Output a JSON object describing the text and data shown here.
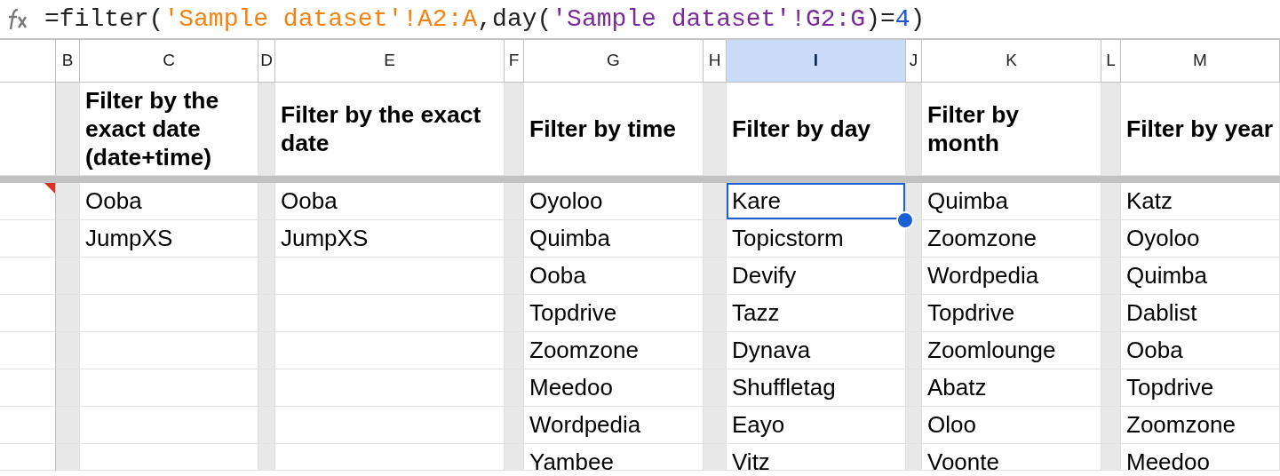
{
  "formula_bar": {
    "tokens": [
      {
        "text": "=filter(",
        "color": "#202124"
      },
      {
        "text": "'Sample dataset'!A2:A",
        "color": "#f4820f"
      },
      {
        "text": ",day(",
        "color": "#202124"
      },
      {
        "text": "'Sample dataset'!G2:G",
        "color": "#7b2a9c"
      },
      {
        "text": ")=",
        "color": "#202124"
      },
      {
        "text": "4",
        "color": "#1a56d6"
      },
      {
        "text": ")",
        "color": "#202124"
      }
    ]
  },
  "first_row_note": true,
  "columns": [
    {
      "letter": "B",
      "kind": "spacer",
      "selected": false
    },
    {
      "letter": "C",
      "kind": "data",
      "selected": false,
      "header": "Filter by the exact date (date+time)",
      "cells": [
        {
          "text": "Ooba",
          "selected": false
        },
        {
          "text": "JumpXS",
          "selected": false
        }
      ]
    },
    {
      "letter": "D",
      "kind": "spacer",
      "selected": false
    },
    {
      "letter": "E",
      "kind": "data",
      "selected": false,
      "header": "Filter by the exact date",
      "cells": [
        {
          "text": "Ooba",
          "selected": false
        },
        {
          "text": "JumpXS",
          "selected": false
        }
      ]
    },
    {
      "letter": "F",
      "kind": "spacer",
      "selected": false
    },
    {
      "letter": "G",
      "kind": "data",
      "selected": false,
      "header": "Filter by time",
      "cells": [
        {
          "text": "Oyoloo",
          "selected": false
        },
        {
          "text": "Quimba",
          "selected": false
        },
        {
          "text": "Ooba",
          "selected": false
        },
        {
          "text": "Topdrive",
          "selected": false
        },
        {
          "text": "Zoomzone",
          "selected": false
        },
        {
          "text": "Meedoo",
          "selected": false
        },
        {
          "text": "Wordpedia",
          "selected": false
        },
        {
          "text": "Yambee",
          "selected": false
        }
      ]
    },
    {
      "letter": "H",
      "kind": "spacer",
      "selected": false
    },
    {
      "letter": "I",
      "kind": "data",
      "selected": true,
      "header": "Filter by day",
      "cells": [
        {
          "text": "Kare",
          "selected": true
        },
        {
          "text": "Topicstorm",
          "selected": false
        },
        {
          "text": "Devify",
          "selected": false
        },
        {
          "text": "Tazz",
          "selected": false
        },
        {
          "text": "Dynava",
          "selected": false
        },
        {
          "text": "Shuffletag",
          "selected": false
        },
        {
          "text": "Eayo",
          "selected": false
        },
        {
          "text": "Vitz",
          "selected": false
        }
      ]
    },
    {
      "letter": "J",
      "kind": "spacer",
      "selected": false
    },
    {
      "letter": "K",
      "kind": "data",
      "selected": false,
      "header": "Filter by month",
      "cells": [
        {
          "text": "Quimba",
          "selected": false
        },
        {
          "text": "Zoomzone",
          "selected": false
        },
        {
          "text": "Wordpedia",
          "selected": false
        },
        {
          "text": "Topdrive",
          "selected": false
        },
        {
          "text": "Zoomlounge",
          "selected": false
        },
        {
          "text": "Abatz",
          "selected": false
        },
        {
          "text": "Oloo",
          "selected": false
        },
        {
          "text": "Voonte",
          "selected": false
        }
      ]
    },
    {
      "letter": "L",
      "kind": "spacer",
      "selected": false
    },
    {
      "letter": "M",
      "kind": "data",
      "selected": false,
      "header": "Filter by year",
      "cells": [
        {
          "text": "Katz",
          "selected": false
        },
        {
          "text": "Oyoloo",
          "selected": false
        },
        {
          "text": "Quimba",
          "selected": false
        },
        {
          "text": "Dablist",
          "selected": false
        },
        {
          "text": "Ooba",
          "selected": false
        },
        {
          "text": "Topdrive",
          "selected": false
        },
        {
          "text": "Zoomzone",
          "selected": false
        },
        {
          "text": "Meedoo",
          "selected": false
        }
      ]
    }
  ]
}
